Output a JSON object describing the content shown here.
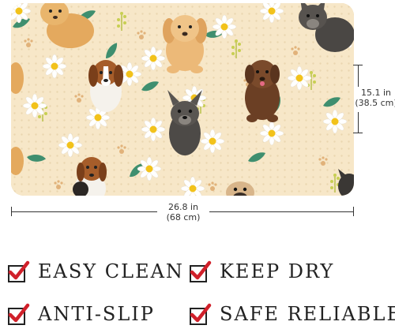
{
  "product": {
    "width_in": "26.8 in",
    "width_cm": "(68 cm)",
    "height_in": "15.1 in",
    "height_cm": "(38.5 cm)"
  },
  "features": [
    {
      "label": "EASY CLEAN"
    },
    {
      "label": "KEEP DRY"
    },
    {
      "label": "ANTI-SLIP"
    },
    {
      "label": "SAFE RELIABLE"
    }
  ],
  "colors": {
    "mat_background": "#f7e7c8",
    "check_red": "#d0202a",
    "leaf_green": "#3f8f6f",
    "daisy_center": "#f2c21b"
  }
}
